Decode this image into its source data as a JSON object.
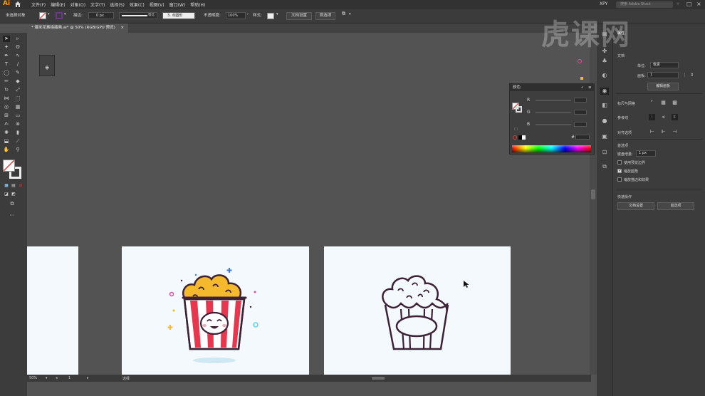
{
  "app": {
    "logo": "Ai",
    "menus": [
      "文件(F)",
      "编辑(E)",
      "对象(O)",
      "文字(T)",
      "选择(S)",
      "效果(C)",
      "视图(V)",
      "窗口(W)",
      "帮助(H)"
    ],
    "workspace": "XPY",
    "search_placeholder": "搜索 Adobe Stock"
  },
  "controlbar": {
    "selection_status": "未选择对象",
    "stroke_label": "描边:",
    "stroke_value": "0 px",
    "stroke_style": "等比",
    "brush_value": "3. 点圆形",
    "opacity_label": "不透明度:",
    "opacity_value": "100%",
    "style_label": "样式:",
    "doc_setup_button": "文档设置",
    "preferences_button": "首选项"
  },
  "document": {
    "tab_title": "* 爆米花素描插画.ai* @ 50% (RGB/GPU 预览)",
    "close_glyph": "×"
  },
  "status": {
    "zoom": "50%",
    "artboard_index": "1",
    "tool_name": "选择"
  },
  "color_panel": {
    "title": "颜色",
    "channels": [
      "R",
      "G",
      "B"
    ],
    "hex_glyph": "#"
  },
  "properties": {
    "title": "属性",
    "doc_section": "文档",
    "units_label": "单位:",
    "units_value": "像素",
    "artboard_label": "画板:",
    "artboard_value": "1",
    "edit_artboard_button": "编辑画板",
    "ruler_grid_label": "标尺与网格",
    "guides_label": "参考线",
    "align_label": "对齐选项",
    "preferences_section": "首选项",
    "keyboard_increment_label": "键盘增量:",
    "keyboard_increment_value": "1 px",
    "checks": [
      {
        "label": "使用预览边界",
        "checked": false
      },
      {
        "label": "缩放圆角",
        "checked": true
      },
      {
        "label": "缩放描边和效果",
        "checked": false
      }
    ],
    "quick_actions": "快速操作",
    "doc_setup_button": "文档设置",
    "preferences_button": "首选项"
  },
  "watermark": "虎课网",
  "colors": {
    "popcorn_yellow": "#f5b92e",
    "stripe_red": "#e8364e",
    "outline": "#3d2237",
    "artboard_bg": "#f3f9fc",
    "spark_pink": "#e64b9f",
    "spark_blue": "#3b7bd6",
    "spark_cyan": "#5ed4e3"
  }
}
